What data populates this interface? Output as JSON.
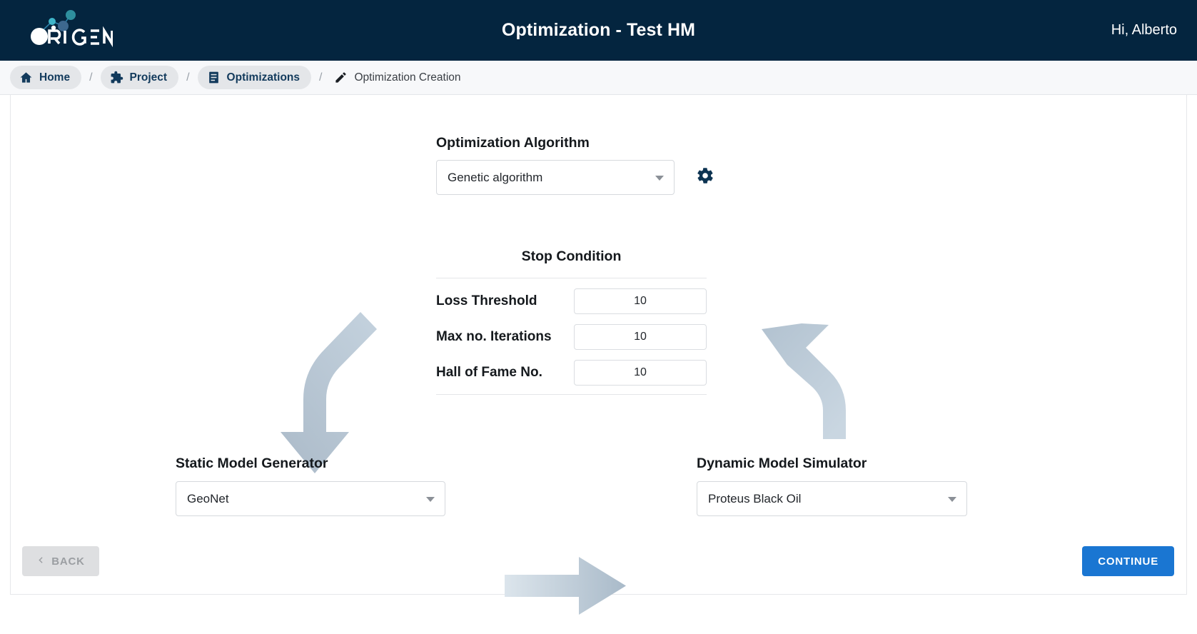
{
  "header": {
    "logo_text": "ORIGEN",
    "title": "Optimization - Test HM",
    "user_greeting": "Hi, Alberto"
  },
  "breadcrumb": {
    "items": [
      {
        "label": "Home",
        "icon": "home-icon"
      },
      {
        "label": "Project",
        "icon": "puzzle-piece-icon"
      },
      {
        "label": "Optimizations",
        "icon": "document-icon"
      },
      {
        "label": "Optimization Creation",
        "icon": "pencil-icon"
      }
    ],
    "separator": "/"
  },
  "algorithm": {
    "label": "Optimization Algorithm",
    "selected": "Genetic algorithm",
    "settings_icon": "gear-icon"
  },
  "stop_condition": {
    "title": "Stop Condition",
    "fields": [
      {
        "label": "Loss Threshold",
        "value": "10"
      },
      {
        "label": "Max no. Iterations",
        "value": "10"
      },
      {
        "label": "Hall of Fame No.",
        "value": "10"
      }
    ]
  },
  "static_model": {
    "label": "Static Model Generator",
    "selected": "GeoNet"
  },
  "dynamic_model": {
    "label": "Dynamic Model Simulator",
    "selected": "Proteus Black Oil"
  },
  "footer": {
    "back_label": "BACK",
    "continue_label": "CONTINUE"
  },
  "colors": {
    "header_bg": "#04253F",
    "primary_button": "#1a76d2",
    "arrow_decor": "#b6c6d4",
    "crumb_text": "#123A5C"
  }
}
